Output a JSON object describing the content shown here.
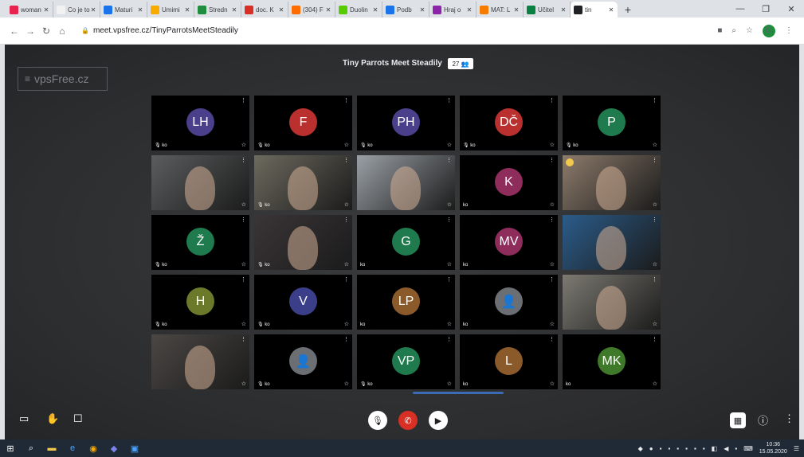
{
  "browser": {
    "tabs": [
      {
        "title": "woman",
        "color": "#e8234e",
        "active": false
      },
      {
        "title": "Co je to",
        "color": "#f2f2f2",
        "active": false
      },
      {
        "title": "Maturi",
        "color": "#1a73e8",
        "active": false
      },
      {
        "title": "Umimi",
        "color": "#f9ab00",
        "active": false
      },
      {
        "title": "Stredn",
        "color": "#1e8e3e",
        "active": false
      },
      {
        "title": "doc. K",
        "color": "#d93025",
        "active": false
      },
      {
        "title": "(304) F",
        "color": "#ff6d00",
        "active": false
      },
      {
        "title": "Duolin",
        "color": "#58cc02",
        "active": false
      },
      {
        "title": "Podb",
        "color": "#1a73e8",
        "active": false
      },
      {
        "title": "Hraj o",
        "color": "#8e24aa",
        "active": false
      },
      {
        "title": "MAT: L",
        "color": "#f57c00",
        "active": false
      },
      {
        "title": "Učitel",
        "color": "#0b8043",
        "active": false
      },
      {
        "title": "tin",
        "color": "#202124",
        "active": true
      }
    ],
    "new_tab": "+",
    "url": "meet.vpsfree.cz/TinyParrotsMeetSteadily",
    "profile_initial": "D"
  },
  "meeting": {
    "logo_text": "vpsFree.cz",
    "title": "Tiny Parrots Meet Steadily",
    "participant_count": "27",
    "tiles": [
      {
        "initials": "LH",
        "color": "#4a3f8a",
        "kind": "avatar",
        "name": "🎙 ko"
      },
      {
        "initials": "F",
        "color": "#b9302f",
        "kind": "avatar",
        "name": "🎙 ko"
      },
      {
        "initials": "PH",
        "color": "#4a3f8a",
        "kind": "avatar",
        "name": "🎙 ko"
      },
      {
        "initials": "DČ",
        "color": "#b9302f",
        "kind": "avatar",
        "name": "🎙 ko"
      },
      {
        "initials": "P",
        "color": "#1f7a4d",
        "kind": "avatar",
        "name": "🎙 ko"
      },
      {
        "initials": "",
        "color": "#5b5d5e",
        "kind": "video",
        "name": ""
      },
      {
        "initials": "",
        "color": "#6d6a5e",
        "kind": "video",
        "name": "🎙 ko"
      },
      {
        "initials": "",
        "color": "#9aa0a6",
        "kind": "video",
        "name": ""
      },
      {
        "initials": "K",
        "color": "#8e2c5c",
        "kind": "avatar",
        "name": "ko"
      },
      {
        "initials": "",
        "color": "#8c7b6b",
        "kind": "video",
        "name": "",
        "hand": true
      },
      {
        "initials": "Ž",
        "color": "#1f7a4d",
        "kind": "avatar",
        "name": "🎙 ko"
      },
      {
        "initials": "",
        "color": "#3a3536",
        "kind": "video",
        "name": "🎙 ko"
      },
      {
        "initials": "G",
        "color": "#1f7a4d",
        "kind": "avatar",
        "name": "ko"
      },
      {
        "initials": "MV",
        "color": "#8e2c5c",
        "kind": "avatar",
        "name": "ko"
      },
      {
        "initials": "",
        "color": "#2b5c8a",
        "kind": "video",
        "name": ""
      },
      {
        "initials": "H",
        "color": "#6b7a2a",
        "kind": "avatar",
        "name": "🎙 ko"
      },
      {
        "initials": "V",
        "color": "#3b3f8a",
        "kind": "avatar",
        "name": "🎙 ko"
      },
      {
        "initials": "LP",
        "color": "#8a5a2a",
        "kind": "avatar",
        "name": "ko"
      },
      {
        "initials": "",
        "color": "#6b6e73",
        "kind": "person",
        "name": "ko"
      },
      {
        "initials": "",
        "color": "#7c7a72",
        "kind": "video",
        "name": ""
      },
      {
        "initials": "",
        "color": "#4b4744",
        "kind": "video",
        "name": ""
      },
      {
        "initials": "",
        "color": "#6b6e73",
        "kind": "person",
        "name": "🎙 ko"
      },
      {
        "initials": "VP",
        "color": "#1f7a4d",
        "kind": "avatar",
        "name": "🎙 ko"
      },
      {
        "initials": "L",
        "color": "#8a5a2a",
        "kind": "avatar",
        "name": "ko"
      },
      {
        "initials": "MK",
        "color": "#3f7a2a",
        "kind": "avatar",
        "name": "ko"
      }
    ]
  },
  "taskbar": {
    "time": "10:36",
    "date": "15.05.2020"
  }
}
